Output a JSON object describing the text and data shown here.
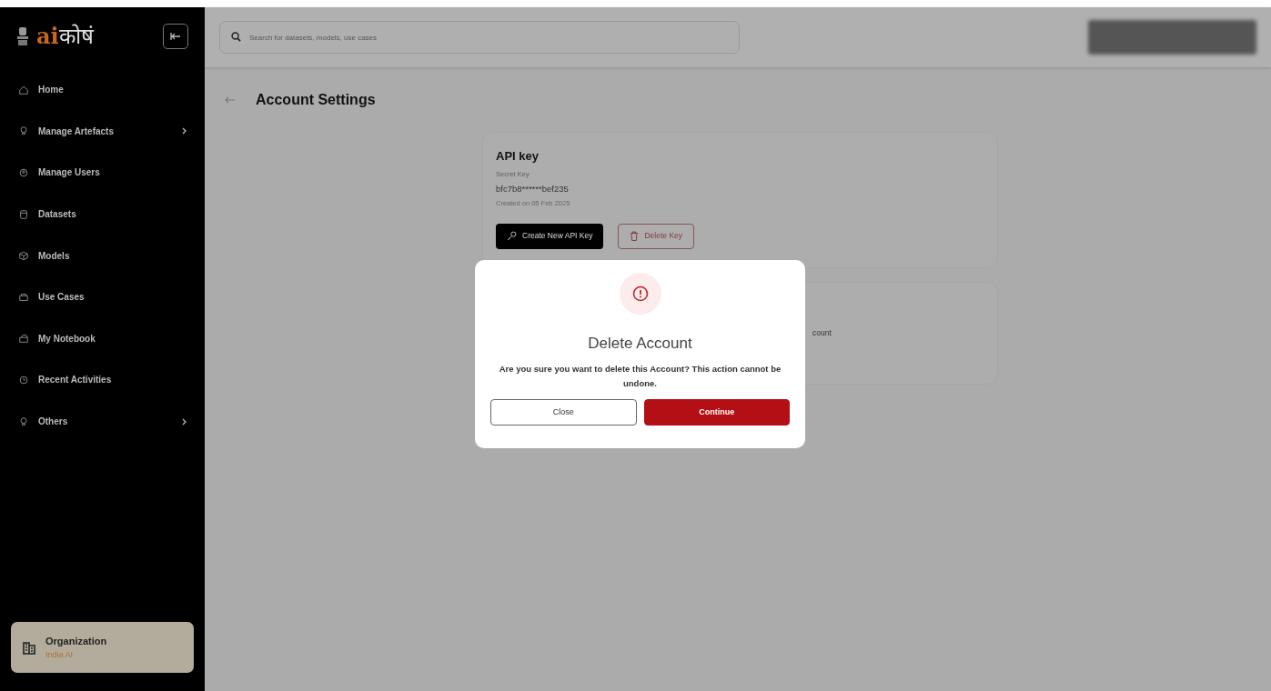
{
  "sidebar": {
    "logo": {
      "latin": "ai",
      "devanagari": "कोषं"
    },
    "items": [
      {
        "label": "Home",
        "has_submenu": false
      },
      {
        "label": "Manage Artefacts",
        "has_submenu": true
      },
      {
        "label": "Manage Users",
        "has_submenu": false
      },
      {
        "label": "Datasets",
        "has_submenu": false
      },
      {
        "label": "Models",
        "has_submenu": false
      },
      {
        "label": "Use Cases",
        "has_submenu": false
      },
      {
        "label": "My Notebook",
        "has_submenu": false
      },
      {
        "label": "Recent Activities",
        "has_submenu": false
      },
      {
        "label": "Others",
        "has_submenu": true
      }
    ],
    "organization": {
      "label": "Organization",
      "name": "India AI"
    }
  },
  "search": {
    "placeholder": "Search for datasets, models, use cases"
  },
  "page_title": "Account Settings",
  "api_key_card": {
    "title": "API key",
    "secret_label": "Secret Key",
    "secret_value": "bfc7b8******bef235",
    "created": "Created on 05 Feb 2025",
    "buttons": [
      "Create New API Key",
      "Delete Key"
    ]
  },
  "account_card": {
    "visible_text": "count"
  },
  "dialog": {
    "title": "Delete Account",
    "message": "Are you sure you want to delete this Account? This action cannot be undone.",
    "buttons": [
      {
        "label": "Close",
        "kind": "secondary"
      },
      {
        "label": "Continue",
        "kind": "danger"
      }
    ]
  }
}
